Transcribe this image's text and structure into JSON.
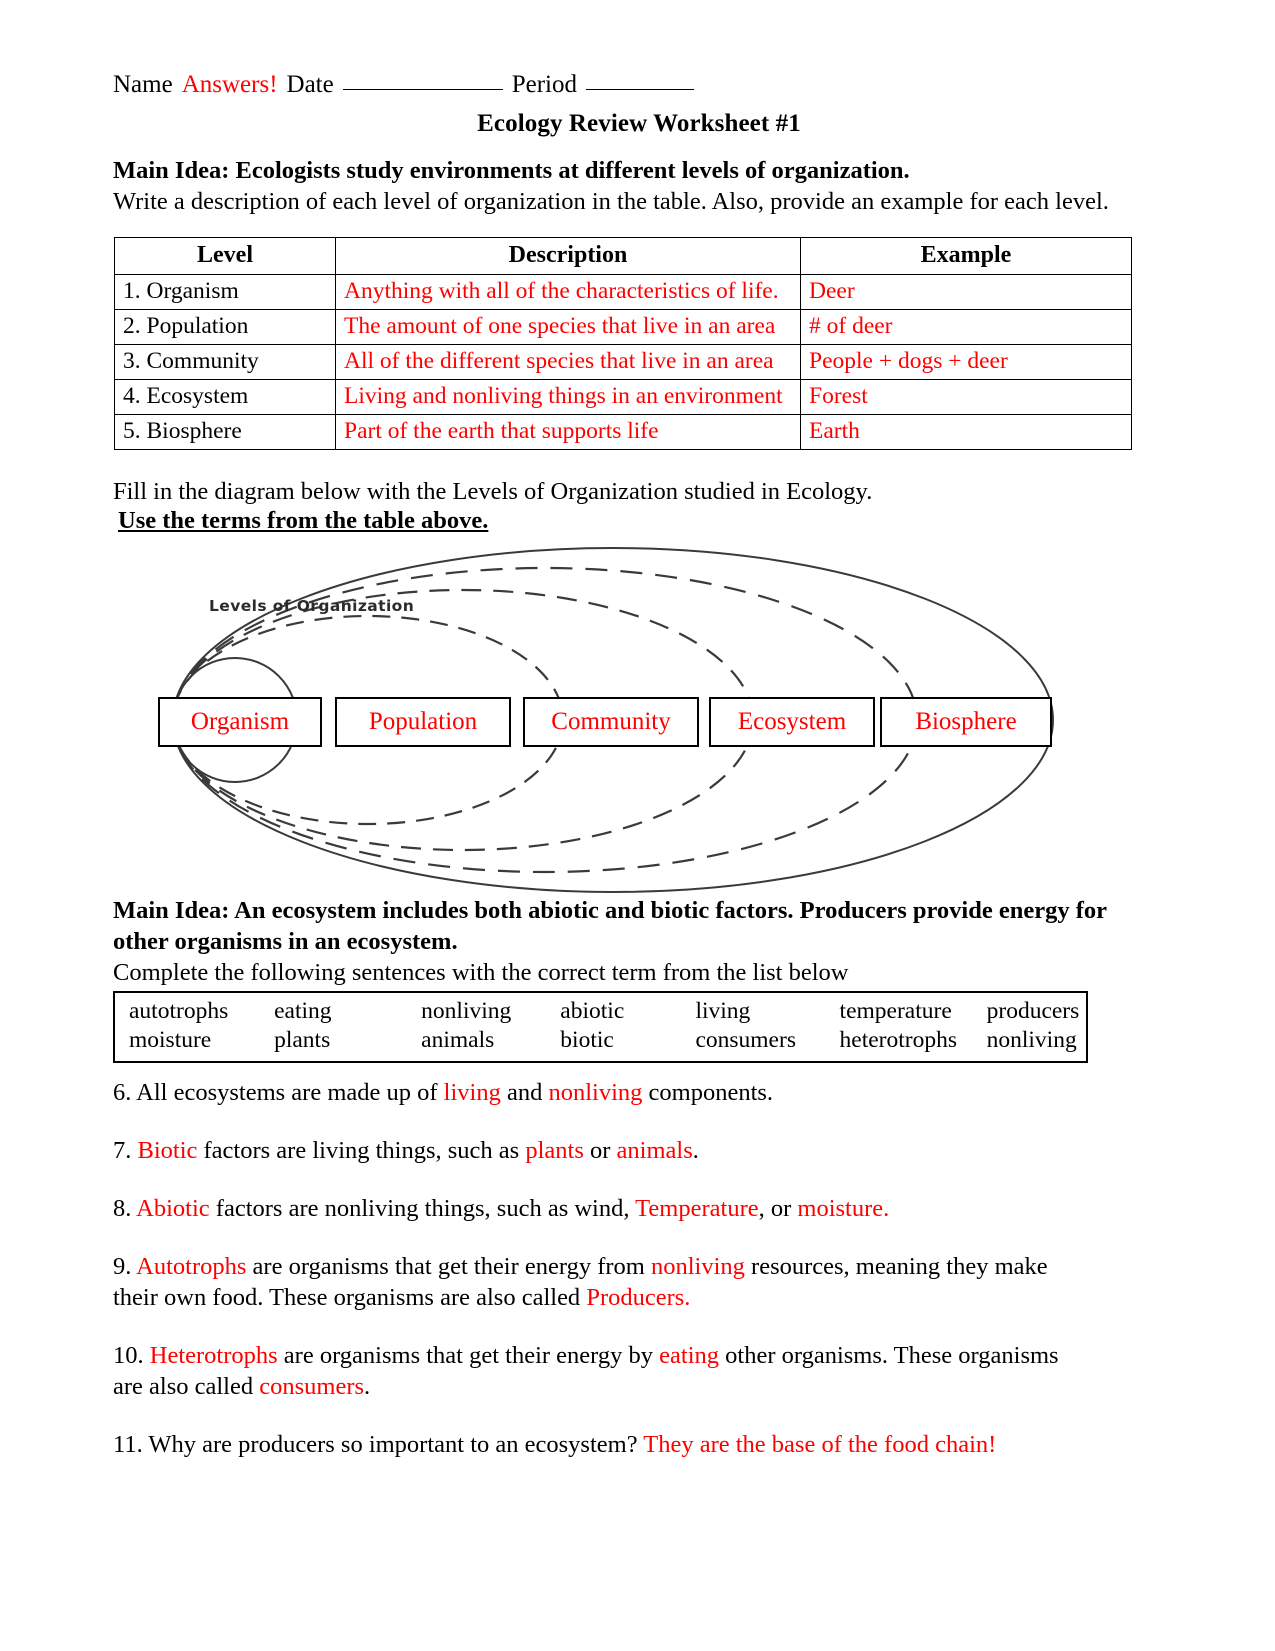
{
  "header": {
    "name_label": "Name",
    "name_value": "Answers!",
    "date_label": "Date",
    "period_label": "Period",
    "title": "Ecology Review Worksheet #1"
  },
  "section1": {
    "main_idea": "Main Idea:  Ecologists study environments at different levels of organization.",
    "instruction": "Write a description of each level of organization in the table.  Also, provide an example for each level.",
    "table": {
      "headers": [
        "Level",
        "Description",
        "Example"
      ],
      "rows": [
        {
          "level": "1. Organism",
          "description": "Anything with all of the characteristics of life.",
          "example": "Deer"
        },
        {
          "level": "2. Population",
          "description": "The amount of one species that live in an area",
          "example": "# of deer"
        },
        {
          "level": "3. Community",
          "description": "All of the different species that live in an area",
          "example": "People + dogs  + deer"
        },
        {
          "level": "4. Ecosystem",
          "description": "Living and nonliving things in an environment",
          "example": "Forest"
        },
        {
          "level": "5. Biosphere",
          "description": "Part of the earth that supports life",
          "example": "Earth"
        }
      ]
    }
  },
  "diagram": {
    "instruction": "Fill in the diagram below with the Levels of Organization studied in Ecology.",
    "emphasis": "Use the terms from the table above.",
    "caption": "Levels of Organization",
    "boxes": [
      {
        "label": "Organism"
      },
      {
        "label": "Population"
      },
      {
        "label": "Community"
      },
      {
        "label": "Ecosystem"
      },
      {
        "label": "Biosphere"
      }
    ]
  },
  "section2": {
    "main_idea": "Main Idea:  An ecosystem includes both abiotic and biotic factors.  Producers provide energy for other organisms in an ecosystem.",
    "instruction": "Complete the following sentences with the correct term from the list below",
    "word_bank": {
      "row1": [
        "autotrophs",
        "eating",
        "nonliving",
        "abiotic",
        "living",
        "temperature",
        "producers"
      ],
      "row2": [
        "moisture",
        "plants",
        "animals",
        "biotic",
        "consumers",
        "heterotrophs",
        "nonliving"
      ]
    },
    "questions": [
      {
        "number": "6.",
        "parts": [
          {
            "text": " All ecosystems are made up of ",
            "color": "black"
          },
          {
            "text": "living",
            "color": "red"
          },
          {
            "text": " and ",
            "color": "black"
          },
          {
            "text": "nonliving",
            "color": "red"
          },
          {
            "text": " components.",
            "color": "black"
          }
        ]
      },
      {
        "number": "7.",
        "parts": [
          {
            "text": " ",
            "color": "black"
          },
          {
            "text": "Biotic",
            "color": "red"
          },
          {
            "text": " factors are living things, such as ",
            "color": "black"
          },
          {
            "text": "plants",
            "color": "red"
          },
          {
            "text": " or ",
            "color": "black"
          },
          {
            "text": "animals",
            "color": "red"
          },
          {
            "text": ".",
            "color": "black"
          }
        ]
      },
      {
        "number": "8.",
        "parts": [
          {
            "text": " ",
            "color": "black"
          },
          {
            "text": "Abiotic",
            "color": "red"
          },
          {
            "text": " factors are nonliving things, such as wind, ",
            "color": "black"
          },
          {
            "text": "Temperature",
            "color": "red"
          },
          {
            "text": ", or ",
            "color": "black"
          },
          {
            "text": "moisture.",
            "color": "red"
          }
        ]
      },
      {
        "number": "9.",
        "parts": [
          {
            "text": " ",
            "color": "black"
          },
          {
            "text": "Autotrophs",
            "color": "red"
          },
          {
            "text": " are organisms that get their energy from ",
            "color": "black"
          },
          {
            "text": "nonliving",
            "color": "red"
          },
          {
            "text": " resources, meaning they make their own food.  These organisms are also called ",
            "color": "black"
          },
          {
            "text": "Producers.",
            "color": "red"
          }
        ]
      },
      {
        "number": "10.",
        "parts": [
          {
            "text": " ",
            "color": "black"
          },
          {
            "text": "Heterotrophs",
            "color": "red"
          },
          {
            "text": " are organisms that get their energy by ",
            "color": "black"
          },
          {
            "text": "eating",
            "color": "red"
          },
          {
            "text": " other organisms.  These organisms are also called ",
            "color": "black"
          },
          {
            "text": "consumers",
            "color": "red"
          },
          {
            "text": ".",
            "color": "black"
          }
        ]
      },
      {
        "number": "11.",
        "parts": [
          {
            "text": " Why are producers so important to an ecosystem? ",
            "color": "black"
          },
          {
            "text": "They are the base of the food chain!",
            "color": "red"
          }
        ]
      }
    ]
  }
}
